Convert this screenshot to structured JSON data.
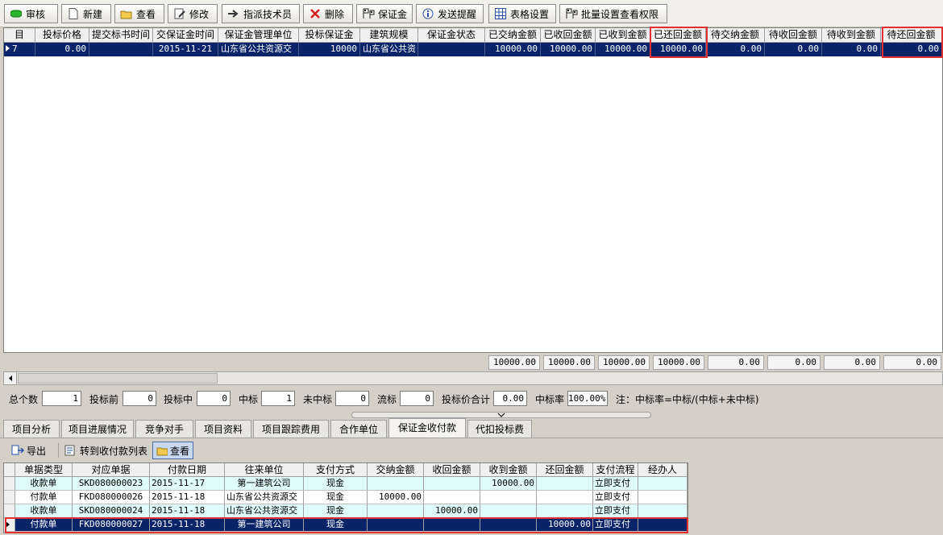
{
  "toolbar": {
    "buttons": [
      "审核",
      "新建",
      "查看",
      "修改",
      "指派技术员",
      "删除",
      "保证金",
      "发送提醒",
      "表格设置",
      "批量设置查看权限"
    ]
  },
  "grid": {
    "columns": [
      "目",
      "投标价格",
      "提交标书时间",
      "交保证金时间",
      "保证金管理单位",
      "投标保证金",
      "建筑规模",
      "保证金状态",
      "已交纳金额",
      "已收回金额",
      "已收到金额",
      "已还回金额",
      "待交纳金额",
      "待收回金额",
      "待收到金额",
      "待还回金额"
    ],
    "row": [
      "7",
      "0.00",
      "",
      "2015-11-21",
      "山东省公共资源交",
      "10000",
      "山东省公共资",
      "",
      "10000.00",
      "10000.00",
      "10000.00",
      "10000.00",
      "0.00",
      "0.00",
      "0.00",
      "0.00"
    ],
    "totals": [
      "10000.00",
      "10000.00",
      "10000.00",
      "10000.00",
      "0.00",
      "0.00",
      "0.00",
      "0.00"
    ]
  },
  "stats": {
    "total_label": "总个数",
    "total": "1",
    "before_label": "投标前",
    "before": "0",
    "during_label": "投标中",
    "during": "0",
    "won_label": "中标",
    "won": "1",
    "lost_label": "未中标",
    "lost": "0",
    "fail_label": "流标",
    "fail": "0",
    "sum_label": "投标价合计",
    "sum": "0.00",
    "rate_label": "中标率",
    "rate": "100.00%",
    "note": "注：中标率=中标/(中标+未中标)"
  },
  "tabs": [
    "项目分析",
    "项目进展情况",
    "竞争对手",
    "项目资料",
    "项目跟踪费用",
    "合作单位",
    "保证金收付款",
    "代扣投标费"
  ],
  "active_tab": 6,
  "subtoolbar": {
    "export": "导出",
    "goto_list": "转到收付款列表",
    "view": "查看"
  },
  "payments": {
    "columns": [
      "单据类型",
      "对应单据",
      "付款日期",
      "往来单位",
      "支付方式",
      "交纳金额",
      "收回金额",
      "收到金额",
      "还回金额",
      "支付流程",
      "经办人"
    ],
    "rows": [
      [
        "收款单",
        "SKD080000023",
        "2015-11-17",
        "第一建筑公司",
        "现金",
        "",
        "",
        "10000.00",
        "",
        "立即支付",
        ""
      ],
      [
        "付款单",
        "FKD080000026",
        "2015-11-18",
        "山东省公共资源交",
        "现金",
        "10000.00",
        "",
        "",
        "",
        "立即支付",
        ""
      ],
      [
        "收款单",
        "SKD080000024",
        "2015-11-18",
        "山东省公共资源交",
        "现金",
        "",
        "10000.00",
        "",
        "",
        "立即支付",
        ""
      ],
      [
        "付款单",
        "FKD080000027",
        "2015-11-18",
        "第一建筑公司",
        "现金",
        "",
        "",
        "",
        "10000.00",
        "立即支付",
        ""
      ]
    ]
  },
  "colors": {
    "selection": "#0a246a",
    "highlight_box": "#e03030",
    "row_alt": "#e0fbfb"
  }
}
